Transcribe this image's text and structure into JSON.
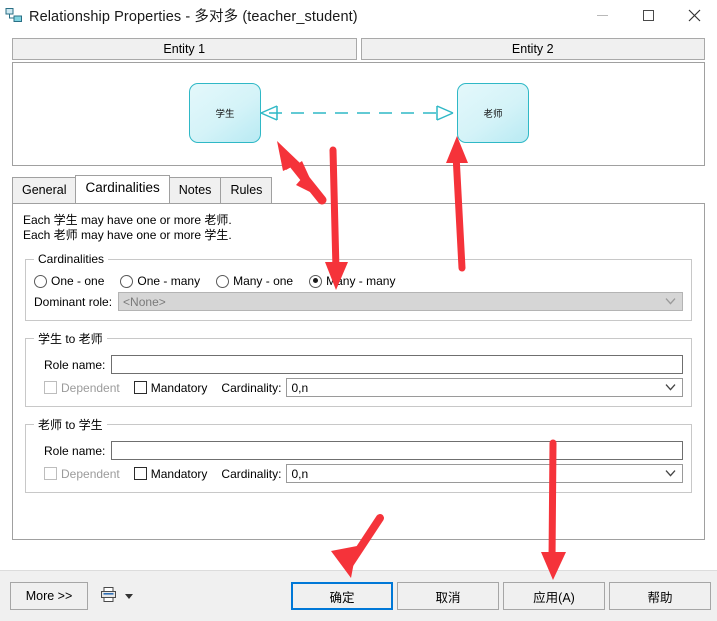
{
  "window": {
    "title": "Relationship Properties - 多对多 (teacher_student)",
    "icon": "relationship-icon",
    "minimize_label": "—",
    "maximize_label": "□",
    "close_label": "✕"
  },
  "entity_panel": {
    "headers": [
      {
        "label": "Entity 1"
      },
      {
        "label": "Entity 2"
      }
    ],
    "diagram": {
      "left_entity": "学生",
      "right_entity": "老师",
      "line_style": "dashed",
      "line_color": "#2fb8c6",
      "entity_fill": "#ddf5f9",
      "entity_border": "#2fb8c6",
      "left_connector": "crows-foot",
      "right_connector": "crows-foot"
    }
  },
  "tabs": [
    {
      "label": "General",
      "active": false
    },
    {
      "label": "Cardinalities",
      "active": true
    },
    {
      "label": "Notes",
      "active": false
    },
    {
      "label": "Rules",
      "active": false
    }
  ],
  "cardinalities_tab": {
    "description": [
      "Each 学生 may have one or more 老师.",
      "Each 老师 may have one or more 学生."
    ],
    "cardinalities_group": {
      "legend": "Cardinalities",
      "options": [
        {
          "label": "One - one",
          "selected": false
        },
        {
          "label": "One - many",
          "selected": false
        },
        {
          "label": "Many - one",
          "selected": false
        },
        {
          "label": "Many - many",
          "selected": true
        }
      ],
      "dominant_role": {
        "label": "Dominant role:",
        "value": "<None>",
        "disabled": true
      }
    },
    "role_groups": [
      {
        "legend": "学生 to 老师",
        "role_name_label": "Role name:",
        "role_name_value": "",
        "dependent_label": "Dependent",
        "dependent_checked": false,
        "dependent_disabled": true,
        "mandatory_label": "Mandatory",
        "mandatory_checked": false,
        "cardinality_label": "Cardinality:",
        "cardinality_value": "0,n"
      },
      {
        "legend": "老师 to 学生",
        "role_name_label": "Role name:",
        "role_name_value": "",
        "dependent_label": "Dependent",
        "dependent_checked": false,
        "dependent_disabled": true,
        "mandatory_label": "Mandatory",
        "mandatory_checked": false,
        "cardinality_label": "Cardinality:",
        "cardinality_value": "0,n"
      }
    ]
  },
  "footer": {
    "more_label": "More >>",
    "print_icon": "printer-icon",
    "print_dropdown_icon": "caret-down-icon",
    "ok_label": "确定",
    "cancel_label": "取消",
    "apply_label": "应用(A)",
    "help_label": "帮助",
    "focus_color": "#0078d7"
  },
  "annotations": {
    "color": "#f5333a",
    "arrows": [
      {
        "name": "arrow-to-left-entity",
        "points_to": "学生 entity box"
      },
      {
        "name": "arrow-to-many-many-radio",
        "points_to": "Many - many radio button"
      },
      {
        "name": "arrow-to-right-entity",
        "points_to": "老师 entity box"
      },
      {
        "name": "arrow-to-ok-button",
        "points_to": "确定 button"
      },
      {
        "name": "arrow-to-apply-button",
        "points_to": "应用(A) button"
      }
    ]
  }
}
